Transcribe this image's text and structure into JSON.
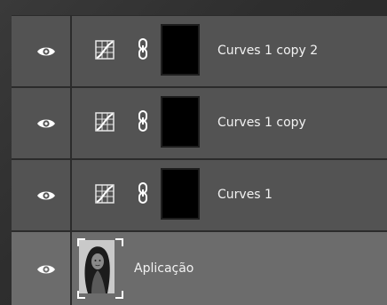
{
  "layers": [
    {
      "name": "Curves 1 copy 2",
      "visibility_icon": "eye-icon",
      "type_icon": "curves-adjustment-icon",
      "link_icon": "chain-link-icon",
      "thumbnail": "black-layer-mask"
    },
    {
      "name": "Curves 1 copy",
      "visibility_icon": "eye-icon",
      "type_icon": "curves-adjustment-icon",
      "link_icon": "chain-link-icon",
      "thumbnail": "black-layer-mask"
    },
    {
      "name": "Curves 1",
      "visibility_icon": "eye-icon",
      "type_icon": "curves-adjustment-icon",
      "link_icon": "chain-link-icon",
      "thumbnail": "black-layer-mask"
    },
    {
      "name": "Aplicação",
      "visibility_icon": "eye-icon",
      "thumbnail": "portrait-photo",
      "selected": true
    }
  ],
  "colors": {
    "row_bg": "#535353",
    "selected_row_bg": "#6c6c6c",
    "separator": "#2b2b2b",
    "text": "#f2f2f2"
  }
}
